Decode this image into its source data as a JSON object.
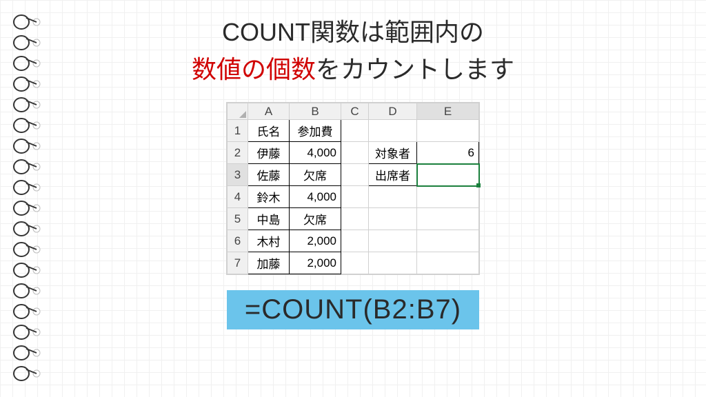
{
  "heading": {
    "line1": "COUNT関数は範囲内の",
    "line2_red": "数値の個数",
    "line2_rest": "をカウントします"
  },
  "columns": [
    "A",
    "B",
    "C",
    "D",
    "E"
  ],
  "rows": [
    "1",
    "2",
    "3",
    "4",
    "5",
    "6",
    "7"
  ],
  "data": {
    "A1": "氏名",
    "B1": "参加費",
    "A2": "伊藤",
    "B2": "4,000",
    "A3": "佐藤",
    "B3": "欠席",
    "A4": "鈴木",
    "B4": "4,000",
    "A5": "中島",
    "B5": "欠席",
    "A6": "木村",
    "B6": "2,000",
    "A7": "加藤",
    "B7": "2,000",
    "D2": "対象者",
    "E2": "6",
    "D3": "出席者",
    "E3": ""
  },
  "formula": "=COUNT(B2:B7)"
}
